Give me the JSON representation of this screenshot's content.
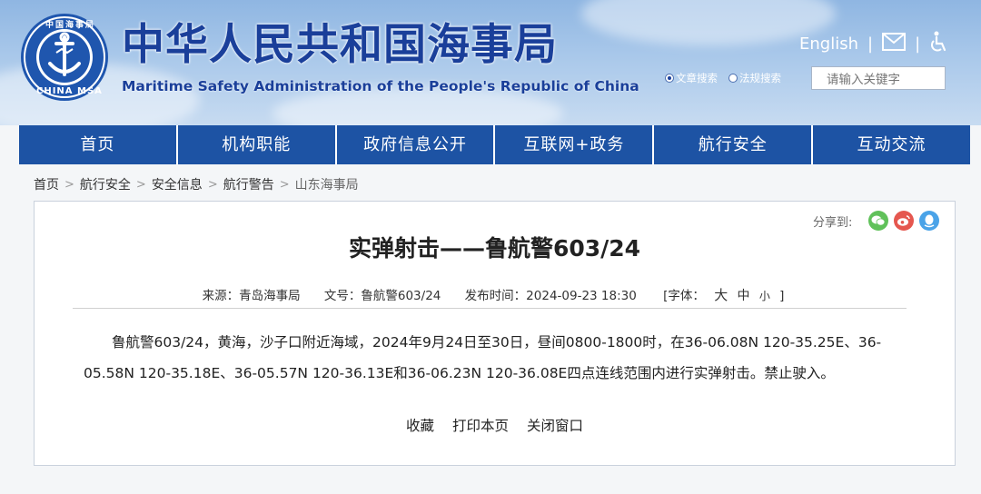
{
  "header": {
    "logo_text": "CHINA MSA",
    "logo_top_text": "中国海事局",
    "title_cn": "中华人民共和国海事局",
    "title_en": "Maritime Safety Administration of the People's Republic of China",
    "english_link": "English",
    "search_options": [
      "文章搜索",
      "法规搜索"
    ],
    "search_placeholder": "请输入关键字"
  },
  "nav": {
    "items": [
      "首页",
      "机构职能",
      "政府信息公开",
      "互联网+政务",
      "航行安全",
      "互动交流"
    ]
  },
  "breadcrumb": [
    "首页",
    "航行安全",
    "安全信息",
    "航行警告",
    "山东海事局"
  ],
  "article": {
    "share_label": "分享到:",
    "title": "实弹射击——鲁航警603/24",
    "source": "来源：青岛海事局",
    "doc_no": "文号：鲁航警603/24",
    "published": "发布时间：2024-09-23 18:30",
    "font_label": "[字体：",
    "font_sizes": [
      "大",
      "中",
      "小"
    ],
    "font_close": "]",
    "body": "鲁航警603/24，黄海，沙子口附近海域，2024年9月24日至30日，昼间0800-1800时，在36-06.08N 120-35.25E、36-05.58N 120-35.18E、36-05.57N 120-36.13E和36-06.23N 120-36.08E四点连线范围内进行实弹射击。禁止驶入。",
    "actions": [
      "收藏",
      "打印本页",
      "关闭窗口"
    ]
  },
  "colors": {
    "nav_bg": "#1d53a4",
    "title_blue": "#1a3f9a",
    "wechat": "#60c15a",
    "weibo": "#e5574f",
    "qq": "#4aa3e8"
  }
}
